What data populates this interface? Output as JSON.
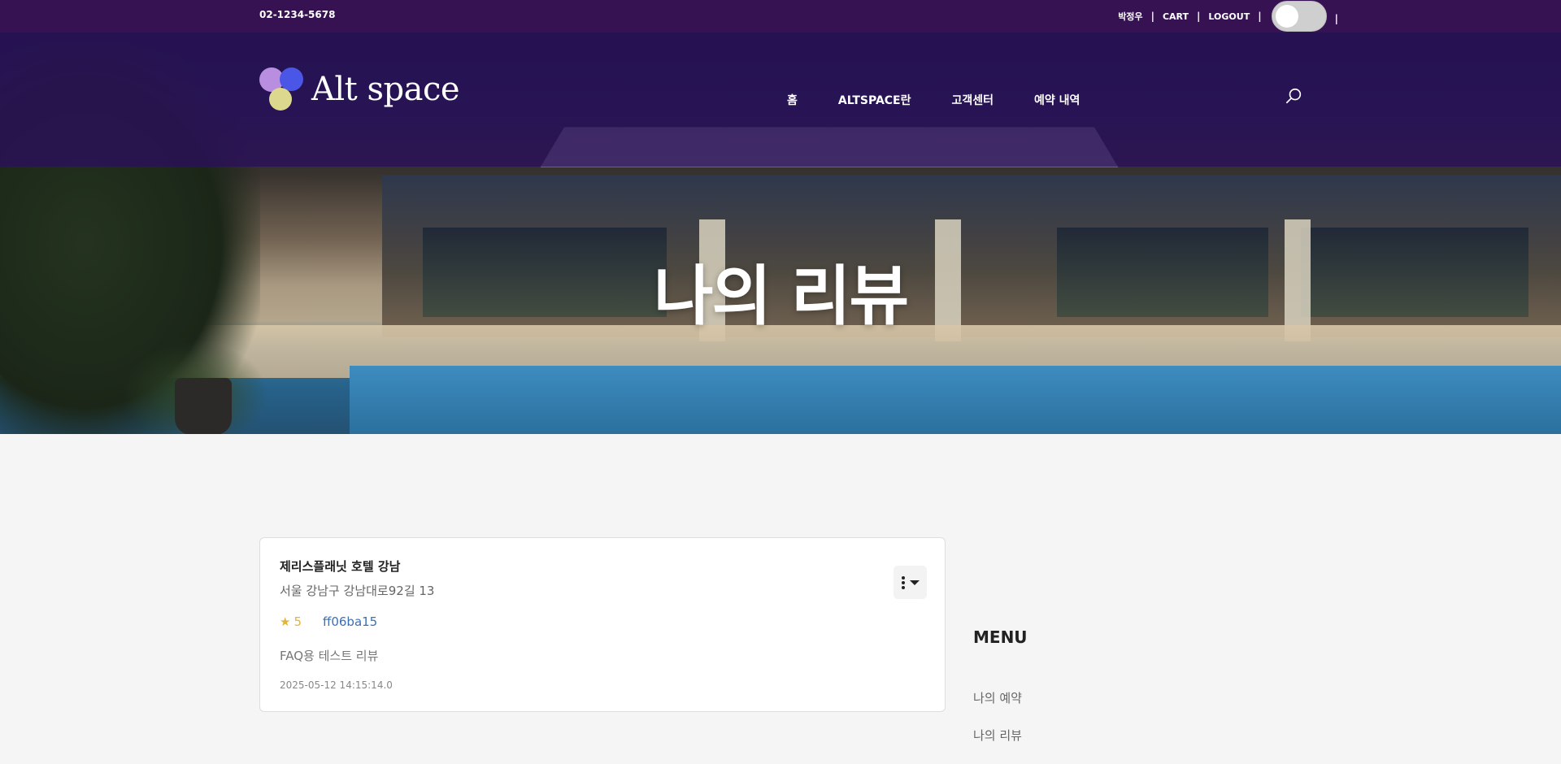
{
  "topbar": {
    "phone": "02-1234-5678",
    "user_name": "박정우",
    "cart_label": "CART",
    "logout_label": "LOGOUT",
    "trailing_sep": "|"
  },
  "header": {
    "logo_text": "Alt space",
    "logo_colors": [
      "#b98ee0",
      "#4a56e6",
      "#dcd98e"
    ],
    "nav": [
      "홈",
      "ALTSPACE란",
      "고객센터",
      "예약 내역"
    ]
  },
  "banner": {
    "title": "나의 리뷰"
  },
  "review": {
    "hotel_name": "제리스플래닛 호텔 강남",
    "address": "서울 강남구 강남대로92길 13",
    "rating": "5",
    "reviewer_id": "ff06ba15",
    "content": "FAQ용 테스트 리뷰",
    "date": "2025-05-12 14:15:14.0"
  },
  "sidebar": {
    "title": "MENU",
    "items": [
      "나의 예약",
      "나의 리뷰"
    ]
  },
  "colors": {
    "topbar_bg": "#361252",
    "star": "#e0b53a",
    "link": "#3b6fb6"
  }
}
